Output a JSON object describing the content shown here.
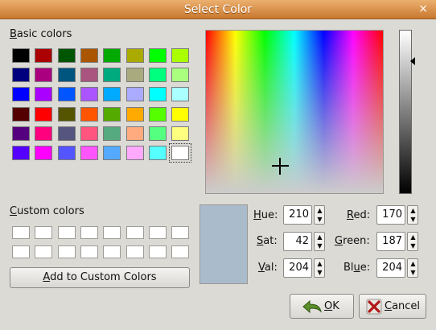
{
  "window": {
    "title": "Select Color",
    "close_glyph": "×"
  },
  "basic": {
    "label_u": "B",
    "label_rest": "asic colors",
    "swatches": [
      "#000000",
      "#aa0000",
      "#005500",
      "#aa5500",
      "#00aa00",
      "#aaaa00",
      "#00ff00",
      "#aaff00",
      "#00007f",
      "#aa007f",
      "#00557f",
      "#aa557f",
      "#00aa7f",
      "#aaaa7f",
      "#00ff7f",
      "#aaff7f",
      "#0000ff",
      "#aa00ff",
      "#0055ff",
      "#aa55ff",
      "#00aaff",
      "#aaaaff",
      "#00ffff",
      "#aaffff",
      "#550000",
      "#ff0000",
      "#555500",
      "#ff5500",
      "#55aa00",
      "#ffaa00",
      "#55ff00",
      "#ffff00",
      "#55007f",
      "#ff007f",
      "#55557f",
      "#ff557f",
      "#55aa7f",
      "#ffaa7f",
      "#55ff7f",
      "#ffff7f",
      "#5500ff",
      "#ff00ff",
      "#5555ff",
      "#ff55ff",
      "#55aaff",
      "#ffaaff",
      "#55ffff",
      "#ffffff"
    ],
    "selected_index": 47
  },
  "custom": {
    "label_u": "C",
    "label_rest": "ustom colors",
    "count": 16
  },
  "add_button": {
    "label_u": "A",
    "label_rest": "dd to Custom Colors"
  },
  "preview_color": "#aabbcc",
  "fields": {
    "hue": {
      "label_u": "H",
      "label_rest": "ue:",
      "value": "210"
    },
    "sat": {
      "label_u": "S",
      "label_rest": "at:",
      "value": "42"
    },
    "val": {
      "label_u": "V",
      "label_rest": "al:",
      "value": "204"
    },
    "red": {
      "label_u": "R",
      "label_rest": "ed:",
      "value": "170"
    },
    "green": {
      "label_u": "G",
      "label_rest": "reen:",
      "value": "187"
    },
    "blue": {
      "label_pre": "Bl",
      "label_u": "u",
      "label_rest": "e:",
      "value": "204"
    }
  },
  "spin": {
    "up": "▲",
    "down": "▼"
  },
  "ok_button": {
    "label_u": "O",
    "label_rest": "K"
  },
  "cancel_button": {
    "label_u": "C",
    "label_rest": "ancel"
  }
}
